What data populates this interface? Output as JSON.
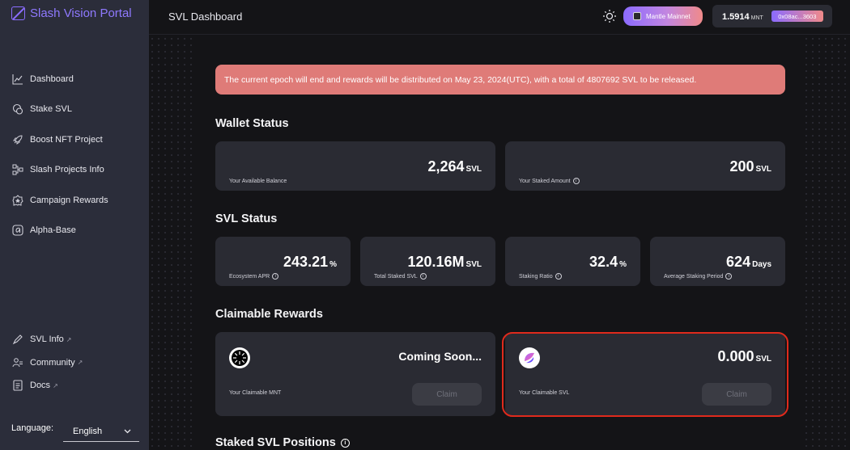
{
  "app": {
    "name": "Slash Vision Portal"
  },
  "sidebar": {
    "items": [
      {
        "label": "Dashboard",
        "icon": "chart-icon"
      },
      {
        "label": "Stake SVL",
        "icon": "coins-icon"
      },
      {
        "label": "Boost NFT Project",
        "icon": "rocket-icon"
      },
      {
        "label": "Slash Projects Info",
        "icon": "nodes-icon"
      },
      {
        "label": "Campaign Rewards",
        "icon": "badge-icon"
      },
      {
        "label": "Alpha-Base",
        "icon": "alpha-icon"
      }
    ],
    "bottom_items": [
      {
        "label": "SVL Info",
        "icon": "pen-icon"
      },
      {
        "label": "Community",
        "icon": "people-icon"
      },
      {
        "label": "Docs",
        "icon": "doc-icon"
      }
    ],
    "language_label": "Language:",
    "language_value": "English"
  },
  "header": {
    "title": "SVL Dashboard",
    "network": "Mantle Mainnet",
    "balance": "1.5914",
    "balance_unit": "MNT",
    "address": "0x08ac...3603"
  },
  "banner": "The current epoch will end and rewards will be distributed on May 23, 2024(UTC), with a total of 4807692 SVL to be released.",
  "wallet_status": {
    "title": "Wallet Status",
    "available": {
      "label": "Your Available Balance",
      "value": "2,264",
      "unit": "SVL"
    },
    "staked": {
      "label": "Your Staked Amount",
      "value": "200",
      "unit": "SVL"
    }
  },
  "svl_status": {
    "title": "SVL Status",
    "cards": [
      {
        "label": "Ecosystem APR",
        "value": "243.21",
        "unit": "%"
      },
      {
        "label": "Total Staked SVL",
        "value": "120.16M",
        "unit": "SVL"
      },
      {
        "label": "Staking Ratio",
        "value": "32.4",
        "unit": "%"
      },
      {
        "label": "Average Staking Period",
        "value": "624",
        "unit": "Days"
      }
    ]
  },
  "claimable": {
    "title": "Claimable Rewards",
    "mnt": {
      "label": "Your Claimable MNT",
      "value": "Coming Soon...",
      "button": "Claim"
    },
    "svl": {
      "label": "Your Claimable SVL",
      "value": "0.000",
      "unit": "SVL",
      "button": "Claim"
    }
  },
  "staked_positions": {
    "title": "Staked SVL Positions"
  },
  "colors": {
    "accent": "#8b6bff",
    "banner": "#df7b78",
    "highlight": "#e02a1c"
  }
}
